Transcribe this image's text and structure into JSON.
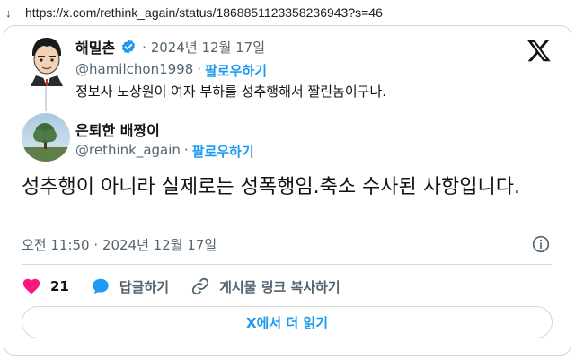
{
  "browser": {
    "back_arrow": "↓",
    "url": "https://x.com/rethink_again/status/1868851123358236943?s=46"
  },
  "quoted_tweet": {
    "name": "해밀촌",
    "verified_color": "#1d9bf0",
    "date": "· 2024년 12월 17일",
    "handle": "@hamilchon1998",
    "separator": "·",
    "follow_label": "팔로우하기",
    "text": "정보사 노상원이 여자 부하를 성추행해서 짤린놈이구나."
  },
  "tweet": {
    "name": "은퇴한 배짱이",
    "handle": "@rethink_again",
    "separator": "·",
    "follow_label": "팔로우하기",
    "text": "성추행이 아니라 실제로는 성폭행임.축소 수사된 사항입니다.",
    "timestamp": "오전 11:50 · 2024년 12월 17일"
  },
  "actions": {
    "like_count": "21",
    "reply_label": "답글하기",
    "copy_link_label": "게시물 링크 복사하기"
  },
  "read_more_label": "X에서 더 읽기",
  "colors": {
    "accent": "#1d9bf0",
    "like": "#f91880",
    "text": "#0f1419",
    "muted": "#536471",
    "border": "#cfd9de"
  },
  "icons": {
    "verified": "verified-badge-icon",
    "x_logo": "x-logo-icon",
    "info": "info-icon",
    "heart": "heart-icon",
    "reply": "reply-bubble-icon",
    "link": "link-icon"
  }
}
